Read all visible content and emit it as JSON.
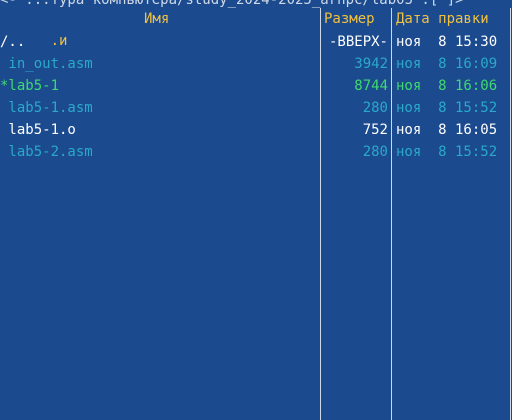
{
  "panel": {
    "path_title": "<- ...тура компьютера/study_2024-2025_arhpc/lab05 .[^]>",
    "columns": {
      "sort_marker": ".и",
      "name": "Имя",
      "size": "Размер",
      "date": "Дата правки"
    },
    "rows": [
      {
        "name": "/..",
        "size": "-ВВЕРХ-",
        "date": "ноя  8 15:30",
        "type": "updir"
      },
      {
        "name": " in_out.asm",
        "size": "3942",
        "date": "ноя  8 16:09",
        "type": "asm"
      },
      {
        "name": "*lab5-1",
        "size": "8744",
        "date": "ноя  8 16:06",
        "type": "exec"
      },
      {
        "name": " lab5-1.asm",
        "size": "280",
        "date": "ноя  8 15:52",
        "type": "asm"
      },
      {
        "name": " lab5-1.o",
        "size": "752",
        "date": "ноя  8 16:05",
        "type": "obj"
      },
      {
        "name": " lab5-2.asm",
        "size": "280",
        "date": "ноя  8 15:52",
        "type": "asm"
      }
    ]
  },
  "colors": {
    "background": "#1b4a8f",
    "header": "#f0c040",
    "asm_file": "#2aa9c9",
    "executable": "#3fd96f",
    "regular": "#ffffff",
    "frame": "#cfd8e6"
  }
}
